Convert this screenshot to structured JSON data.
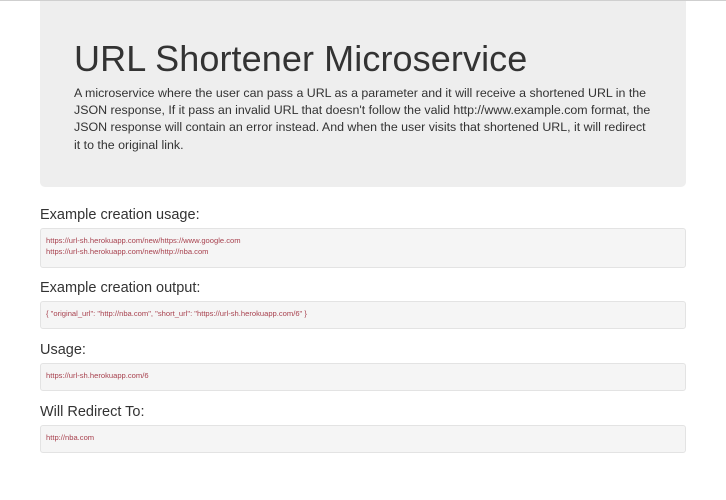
{
  "jumbotron": {
    "title": "URL Shortener Microservice",
    "description": "A microservice where the user can pass a URL as a parameter and it will receive a shortened URL in the JSON response, If it pass an invalid URL that doesn't follow the valid http://www.example.com format, the JSON response will contain an error instead. And when the user visits that shortened URL, it will redirect it to the original link."
  },
  "sections": [
    {
      "title": "Example creation usage:",
      "lines": [
        "https://url-sh.herokuapp.com/new/https://www.google.com",
        "https://url-sh.herokuapp.com/new/http://nba.com"
      ]
    },
    {
      "title": "Example creation output:",
      "lines": [
        "{ \"original_url\": \"http://nba.com\", \"short_url\": \"https://url-sh.herokuapp.com/6\" }"
      ]
    },
    {
      "title": "Usage:",
      "lines": [
        "https://url-sh.herokuapp.com/6"
      ]
    },
    {
      "title": "Will Redirect To:",
      "lines": [
        "http://nba.com"
      ]
    }
  ],
  "colors": {
    "background": "#ffffff",
    "jumbotron": "#eeeeee",
    "text": "#333333",
    "code_background": "#f5f5f5",
    "code_text": "#a8424f"
  }
}
